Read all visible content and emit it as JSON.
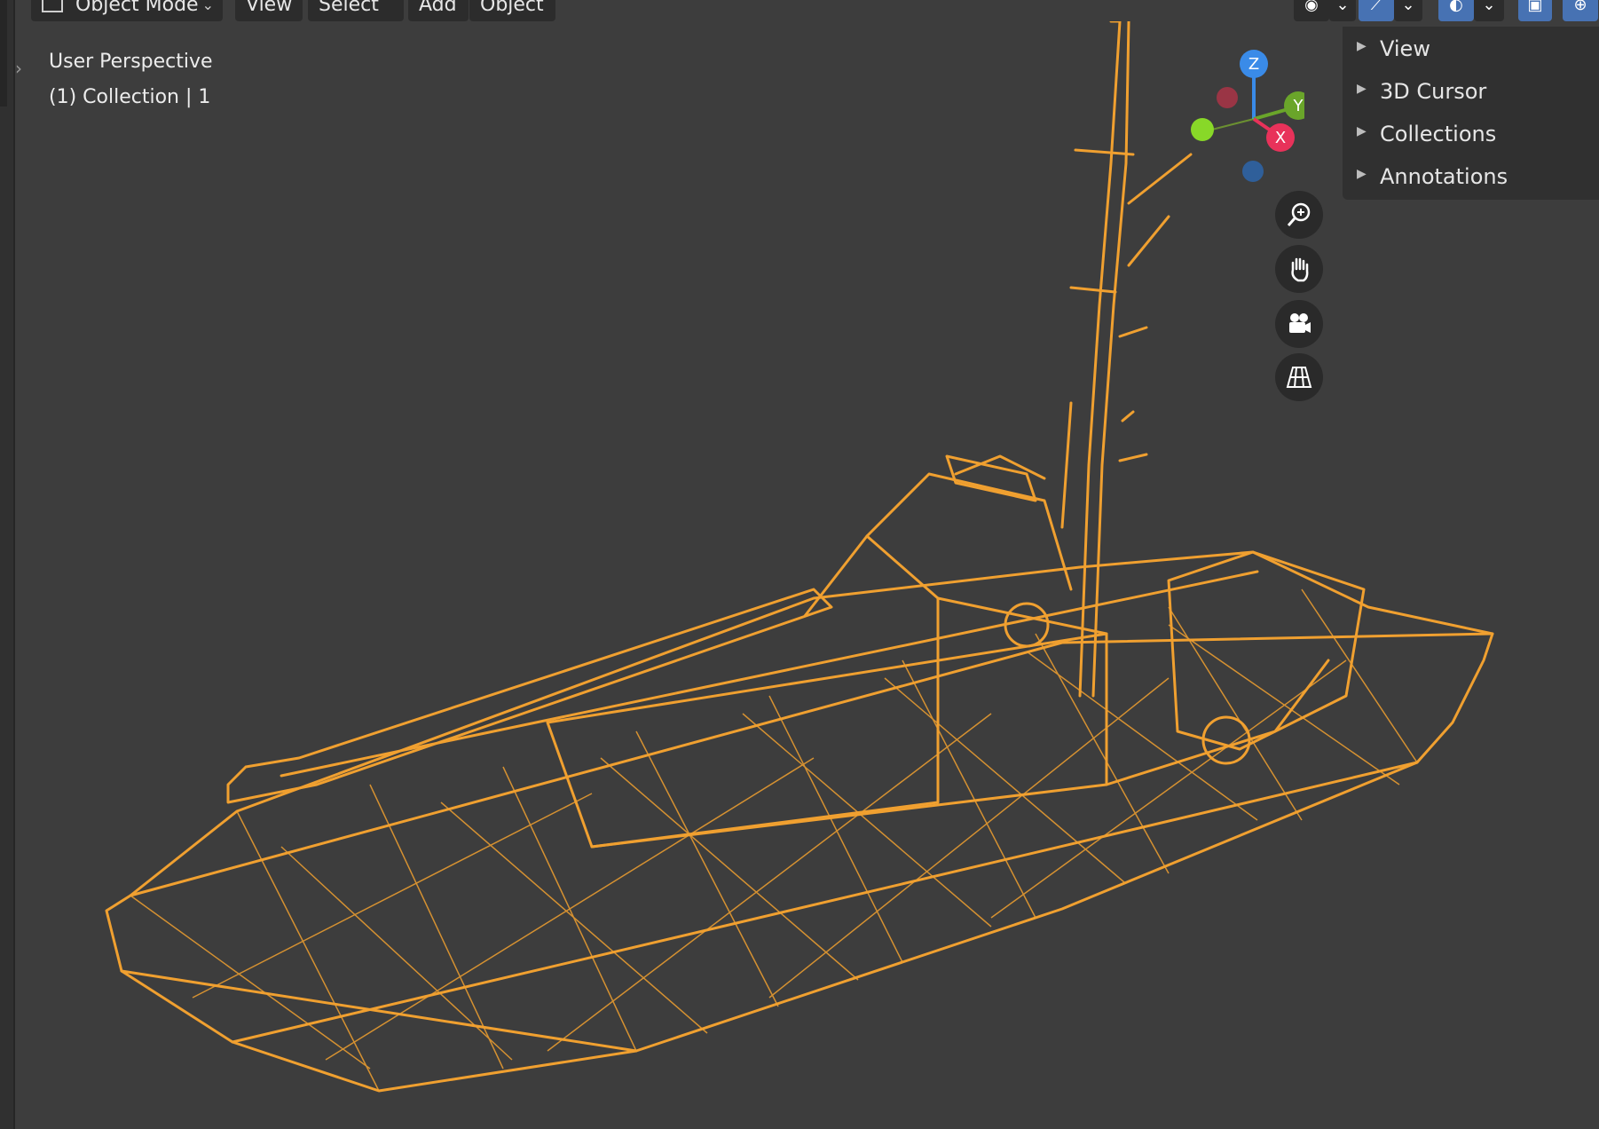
{
  "header": {
    "mode": {
      "label": "Object Mode",
      "icon": "object-mode-icon"
    },
    "menus": [
      "View",
      "Select",
      "Add",
      "Object"
    ],
    "right_icons": [
      "viewport-gizmos-icon",
      "snapping-icon",
      "overlays-icon",
      "xray-icon",
      "wireframe-shading-icon"
    ]
  },
  "viewport": {
    "perspective_label": "User Perspective",
    "collection_label": "(1) Collection | 1",
    "object_color": "#f0a030",
    "background_color": "#3d3d3d"
  },
  "side_panel": {
    "items": [
      {
        "label": "View"
      },
      {
        "label": "3D Cursor"
      },
      {
        "label": "Collections"
      },
      {
        "label": "Annotations"
      }
    ]
  },
  "navigation": {
    "buttons": [
      "zoom-icon",
      "pan-hand-icon",
      "camera-icon",
      "ortho-grid-icon"
    ]
  },
  "axis_gizmo": {
    "labels": {
      "z": "Z",
      "y": "Y",
      "x": "X"
    },
    "colors": {
      "x": "#e8325a",
      "y": "#6aa52a",
      "z": "#3a8be8"
    }
  }
}
